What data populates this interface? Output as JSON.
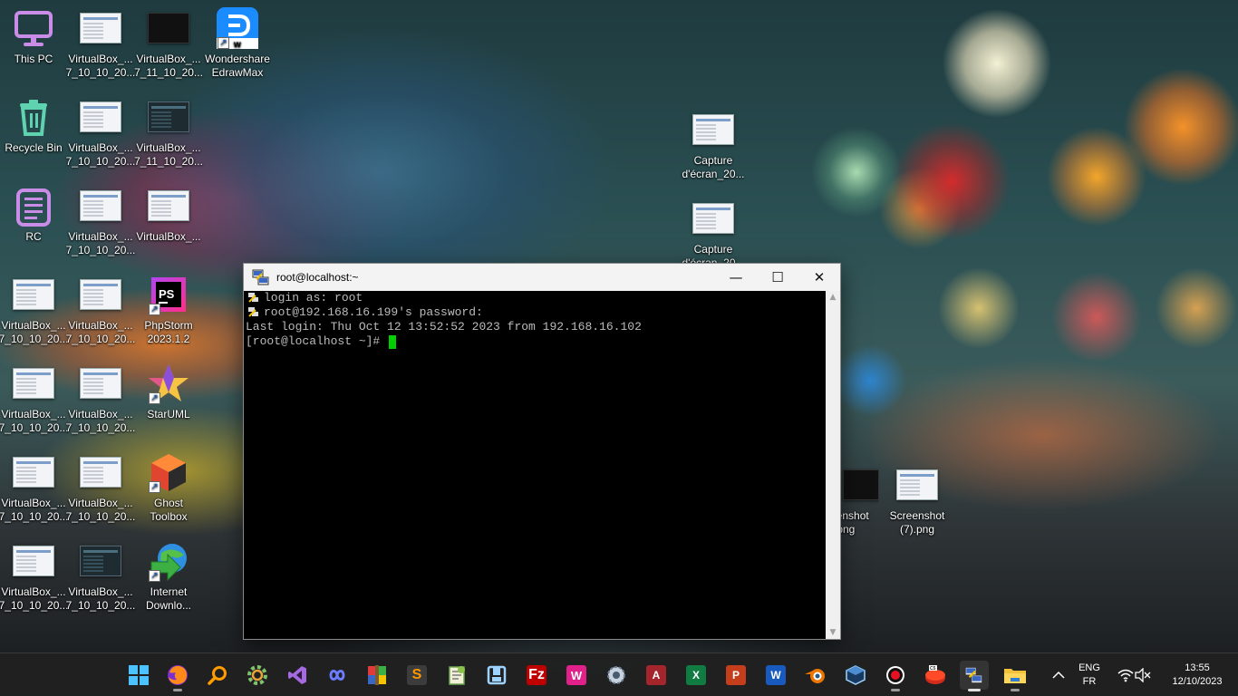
{
  "desktop": {
    "icons": [
      {
        "label": "This PC"
      },
      {
        "label": "VirtualBox_...\n7_10_10_20..."
      },
      {
        "label": "VirtualBox_...\n7_11_10_20..."
      },
      {
        "label": "Wondershare\nEdrawMax"
      },
      {
        "label": "Recycle Bin"
      },
      {
        "label": "VirtualBox_...\n7_10_10_20..."
      },
      {
        "label": "VirtualBox_...\n7_11_10_20..."
      },
      {
        "label": "RC"
      },
      {
        "label": "VirtualBox_...\n7_10_10_20..."
      },
      {
        "label": "VirtualBox_..."
      },
      {
        "label": "VirtualBox_...\n7_10_10_20..."
      },
      {
        "label": "VirtualBox_...\n7_10_10_20..."
      },
      {
        "label": "PhpStorm\n2023.1.2"
      },
      {
        "label": "VirtualBox_...\n7_10_10_20..."
      },
      {
        "label": "VirtualBox_...\n7_10_10_20..."
      },
      {
        "label": "StarUML"
      },
      {
        "label": "VirtualBox_...\n7_10_10_20..."
      },
      {
        "label": "VirtualBox_...\n7_10_10_20..."
      },
      {
        "label": "Ghost\nToolbox"
      },
      {
        "label": "VirtualBox_...\n7_10_10_20..."
      },
      {
        "label": "VirtualBox_...\n7_10_10_20..."
      },
      {
        "label": "Internet\nDownlo..."
      },
      {
        "label": "Capture\nd'écran_20..."
      },
      {
        "label": "Capture\nd'écran_20..."
      },
      {
        "label": "eenshot\n).png"
      },
      {
        "label": "Screenshot\n(7).png"
      }
    ]
  },
  "terminal": {
    "title": "root@localhost:~",
    "lines": [
      "login as: root",
      "root@192.168.16.199's password:",
      "Last login: Thu Oct 12 13:52:52 2023 from 192.168.16.102",
      "[root@localhost ~]# "
    ],
    "cursor_color": "#00d000"
  },
  "taskbar": {
    "apps": [
      "start-icon",
      "firefox-icon",
      "search-icon",
      "settings-icon",
      "visual-studio-icon",
      "infinity-icon",
      "winrar-icon",
      "sublime-text-icon",
      "notepad-plus-plus-icon",
      "virtualbox-manager-icon",
      "filezilla-icon",
      "wampserver-icon",
      "gear-app-icon",
      "access-icon",
      "excel-icon",
      "powerpoint-icon",
      "word-icon",
      "blender-icon",
      "virtualbox-icon",
      "recorder-icon",
      "cs-app-icon",
      "putty-icon",
      "file-explorer-icon"
    ],
    "lang_top": "ENG",
    "lang_bottom": "FR",
    "time": "13:55",
    "date": "12/10/2023"
  }
}
